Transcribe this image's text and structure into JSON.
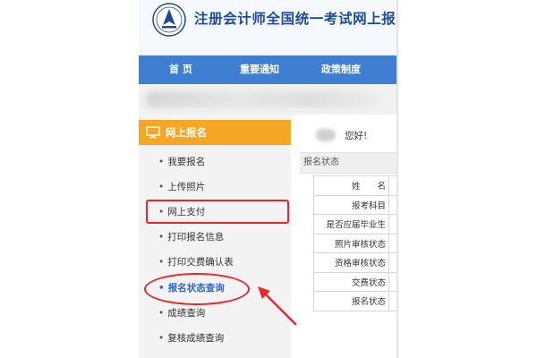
{
  "header": {
    "site_title": "注册会计师全国统一考试网上报名",
    "logo_icon": "cpa-logo-icon"
  },
  "nav": {
    "items": [
      {
        "label": "首 页"
      },
      {
        "label": "重要通知"
      },
      {
        "label": "政策制度"
      }
    ]
  },
  "sidebar": {
    "header_label": "网上报名",
    "header_icon": "monitor-icon",
    "items": [
      {
        "label": "我要报名"
      },
      {
        "label": "上传照片"
      },
      {
        "label": "网上支付"
      },
      {
        "label": "打印报名信息"
      },
      {
        "label": "打印交费确认表"
      },
      {
        "label": "报名状态查询"
      },
      {
        "label": "成绩查询"
      },
      {
        "label": "复核成绩查询"
      }
    ],
    "active_index": 5
  },
  "main": {
    "greeting": "您好!",
    "status_section_title": "报名状态",
    "rows": [
      {
        "label": "姓　　名"
      },
      {
        "label": "报考科目"
      },
      {
        "label": "是否应届毕业生"
      },
      {
        "label": "照片审核状态"
      },
      {
        "label": "资格审核状态"
      },
      {
        "label": "交费状态"
      },
      {
        "label": "报名状态"
      }
    ]
  },
  "colors": {
    "nav_bg": "#3f7fd2",
    "sidebar_header_bg": "#f5a623",
    "title_text": "#1d4c9c",
    "active_link": "#2c66c8",
    "annotation_red": "#e8262b"
  }
}
